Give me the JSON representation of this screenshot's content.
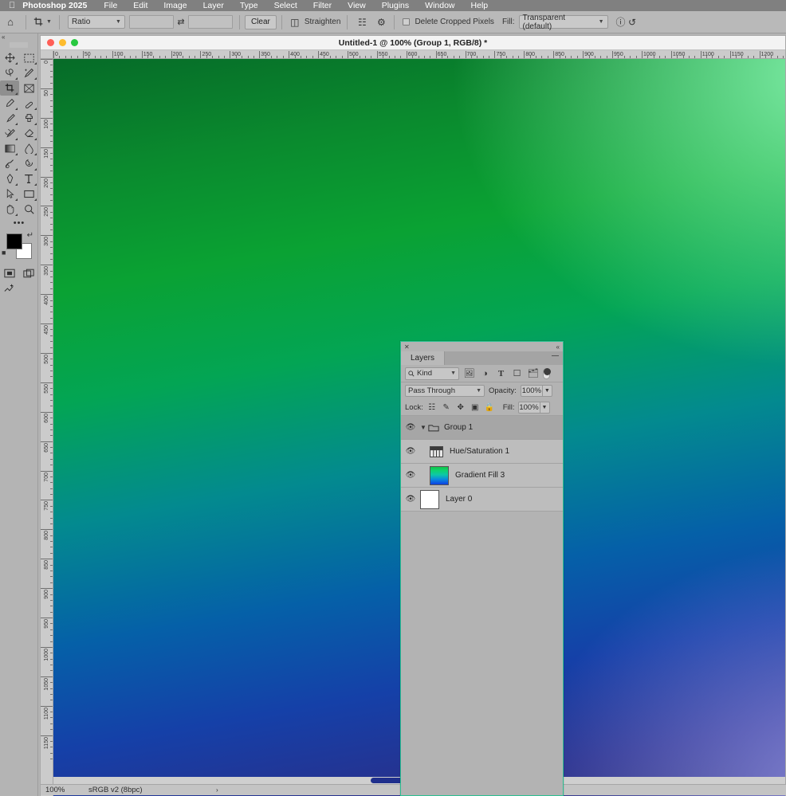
{
  "menubar": {
    "apple_icon": "apple-icon",
    "app_name": "Photoshop 2025",
    "items": [
      "File",
      "Edit",
      "Image",
      "Layer",
      "Type",
      "Select",
      "Filter",
      "View",
      "Plugins",
      "Window",
      "Help"
    ]
  },
  "options_bar": {
    "home_icon": "home-icon",
    "tool_icon": "crop-tool-icon",
    "ratio_label": "Ratio",
    "width_value": "",
    "height_value": "",
    "swap_icon": "swap-arrows-icon",
    "clear_label": "Clear",
    "straighten_icon": "straighten-icon",
    "straighten_label": "Straighten",
    "overlay_icon": "grid-overlay-icon",
    "settings_icon": "gear-icon",
    "delete_cropped_label": "Delete Cropped Pixels",
    "delete_cropped_checked": false,
    "fill_label": "Fill:",
    "fill_value": "Transparent (default)",
    "info_icon": "info-icon",
    "reset_icon": "reset-icon"
  },
  "toolbar": {
    "collapse_icon": "collapse-panel-icon",
    "tools": [
      {
        "name": "move-tool",
        "active": false,
        "has_flyout": true
      },
      {
        "name": "marquee-tool",
        "active": false,
        "has_flyout": true
      },
      {
        "name": "lasso-tool",
        "active": false,
        "has_flyout": true
      },
      {
        "name": "quick-select-tool",
        "active": false,
        "has_flyout": true
      },
      {
        "name": "crop-tool",
        "active": true,
        "has_flyout": true
      },
      {
        "name": "frame-tool",
        "active": false,
        "has_flyout": false
      },
      {
        "name": "eyedropper-tool",
        "active": false,
        "has_flyout": true
      },
      {
        "name": "healing-brush-tool",
        "active": false,
        "has_flyout": true
      },
      {
        "name": "brush-tool",
        "active": false,
        "has_flyout": true
      },
      {
        "name": "clone-stamp-tool",
        "active": false,
        "has_flyout": true
      },
      {
        "name": "history-brush-tool",
        "active": false,
        "has_flyout": true
      },
      {
        "name": "eraser-tool",
        "active": false,
        "has_flyout": true
      },
      {
        "name": "gradient-tool",
        "active": false,
        "has_flyout": true
      },
      {
        "name": "blur-tool",
        "active": false,
        "has_flyout": true
      },
      {
        "name": "dodge-tool",
        "active": false,
        "has_flyout": true
      },
      {
        "name": "burn-tool",
        "active": false,
        "has_flyout": true
      },
      {
        "name": "pen-tool",
        "active": false,
        "has_flyout": true
      },
      {
        "name": "type-tool",
        "active": false,
        "has_flyout": true
      },
      {
        "name": "path-selection-tool",
        "active": false,
        "has_flyout": true
      },
      {
        "name": "shape-tool",
        "active": false,
        "has_flyout": true
      },
      {
        "name": "hand-tool",
        "active": false,
        "has_flyout": true
      },
      {
        "name": "zoom-tool",
        "active": false,
        "has_flyout": false
      }
    ],
    "more_tools_label": "•••",
    "foreground_color": "#000000",
    "background_color": "#ffffff",
    "swap_colors_icon": "swap-colors-icon",
    "default_colors_icon": "default-colors-icon",
    "quick_mask_icon": "quick-mask-icon",
    "screen_mode_icon": "screen-mode-icon",
    "edit_toolbar_icon": "edit-toolbar-icon"
  },
  "document": {
    "title": "Untitled-1 @ 100% (Group 1, RGB/8) *",
    "traffic_lights": [
      "close",
      "minimize",
      "zoom"
    ],
    "ruler_h_labels": [
      "0",
      "50",
      "100",
      "150",
      "200",
      "250",
      "300",
      "350",
      "400",
      "450",
      "500",
      "550",
      "600",
      "650",
      "700",
      "750",
      "800",
      "850",
      "900",
      "950",
      "1000",
      "1050",
      "1100",
      "1150",
      "1200"
    ],
    "ruler_v_labels": [
      "0",
      "50",
      "100",
      "150",
      "200",
      "250",
      "300",
      "350",
      "400",
      "450",
      "500",
      "550",
      "600",
      "650",
      "700",
      "750",
      "800",
      "850",
      "900",
      "950",
      "1000",
      "1050",
      "1100",
      "1150"
    ],
    "status_zoom": "100%",
    "status_colorspace": "sRGB v2 (8bpc)",
    "status_arrow": "›"
  },
  "layers_panel": {
    "close_icon": "close-icon",
    "collapse_icon": "collapse-icon",
    "tab_label": "Layers",
    "menu_icon": "panel-menu-icon",
    "filter_kind_label": "Kind",
    "search_icon": "search-icon",
    "filter_icons": [
      "pixel-filter-icon",
      "adjustment-filter-icon",
      "type-filter-icon",
      "shape-filter-icon",
      "smart-object-filter-icon"
    ],
    "filter_toggle_on": true,
    "blend_mode": "Pass Through",
    "opacity_label": "Opacity:",
    "opacity_value": "100%",
    "lock_label": "Lock:",
    "lock_icons": [
      "lock-transparent-icon",
      "lock-image-icon",
      "lock-position-icon",
      "lock-artboard-icon",
      "lock-all-icon"
    ],
    "fill_label": "Fill:",
    "fill_value": "100%",
    "layers": [
      {
        "name": "Group 1",
        "type": "group",
        "visible": true,
        "selected": true,
        "expanded": true,
        "thumb": "folder"
      },
      {
        "name": "Hue/Saturation 1",
        "type": "adjustment",
        "visible": true,
        "selected": false,
        "indent": true,
        "thumb": "hue-saturation"
      },
      {
        "name": "Gradient Fill 3",
        "type": "fill",
        "visible": true,
        "selected": false,
        "indent": false,
        "thumb": "gradient"
      },
      {
        "name": "Layer 0",
        "type": "pixel",
        "visible": true,
        "selected": false,
        "indent": false,
        "thumb": "white"
      }
    ],
    "accent_color": "#2bbf91",
    "eye_icon": "eye-icon"
  }
}
